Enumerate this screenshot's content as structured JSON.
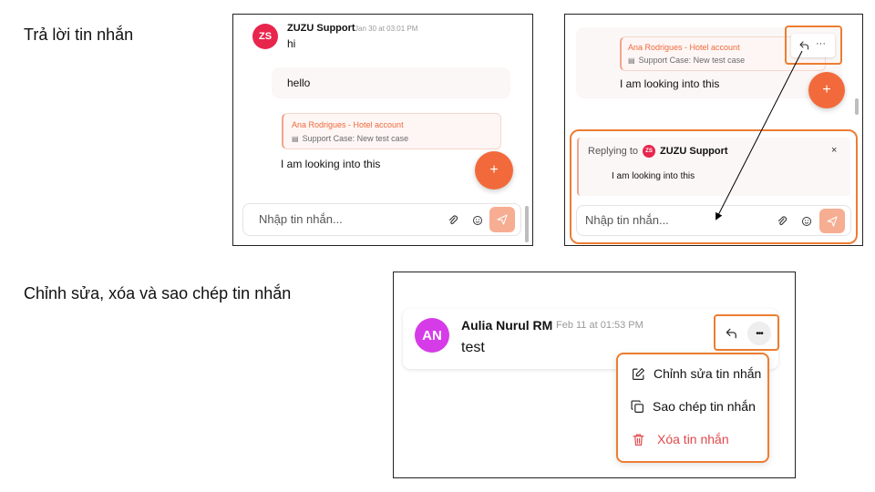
{
  "labels": {
    "reply_section": "Trả lời tin nhắn",
    "edit_section": "Chỉnh sửa, xóa và sao chép tin nhắn"
  },
  "panel1": {
    "sender_initials": "ZS",
    "sender_name": "ZUZU Support",
    "timestamp": "Jan 30 at 03:01 PM",
    "msg_hi": "hi",
    "msg_hello": "hello",
    "quote_title": "Ana Rodrigues - Hotel account",
    "quote_subtitle": "Support Case: New test case",
    "reply_text": "I am looking into this",
    "fab_label": "+",
    "composer_placeholder": "Nhập tin nhắn..."
  },
  "panel2": {
    "quote_title": "Ana Rodrigues - Hotel account",
    "quote_subtitle": "Support Case: New test case",
    "reply_text": "I am looking into this",
    "more_label": "···",
    "fab_label": "+",
    "replying_prefix": "Replying to",
    "replying_initials": "ZS",
    "replying_name": "ZUZU Support",
    "close_label": "×",
    "replying_preview": "I am looking into this",
    "composer_placeholder": "Nhập tin nhắn..."
  },
  "panel3": {
    "sender_initials": "AN",
    "sender_name": "Aulia Nurul RM",
    "timestamp": "Feb 11 at 01:53 PM",
    "message": "test",
    "more_label": "•••",
    "menu": [
      {
        "label": "Chỉnh sửa tin nhắn",
        "icon": "edit-icon"
      },
      {
        "label": "Sao chép tin nhắn",
        "icon": "copy-icon"
      },
      {
        "label": "Xóa tin nhắn",
        "icon": "trash-icon"
      }
    ]
  },
  "colors": {
    "accent": "#ed7d31",
    "brand": "#f26a3b",
    "avatar_zs": "#e8264d",
    "avatar_an": "#d63be8",
    "danger": "#e0484b"
  }
}
